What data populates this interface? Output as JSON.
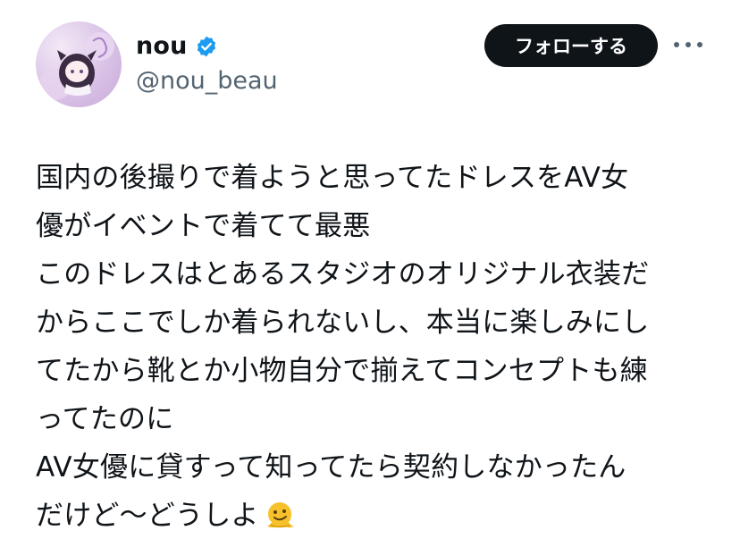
{
  "user": {
    "display_name": "nou",
    "handle": "@nou_beau",
    "verified": true
  },
  "actions": {
    "follow_label": "フォローする"
  },
  "tweet": {
    "lines": [
      "国内の後撮りで着ようと思ってたドレスをAV女",
      "優がイベントで着てて最悪",
      "このドレスはとあるスタジオのオリジナル衣装だ",
      "からここでしか着られないし、本当に楽しみにし",
      "てたから靴とか小物自分で揃えてコンセプトも練",
      "ってたのに",
      "AV女優に貸すって知ってたら契約しなかったん",
      "だけど〜どうしよ"
    ],
    "trailing_emoji": "melting-face-icon"
  },
  "colors": {
    "text": "#0f1419",
    "secondary": "#536471",
    "verified_blue": "#1d9bf0",
    "button_bg": "#0f1419"
  }
}
